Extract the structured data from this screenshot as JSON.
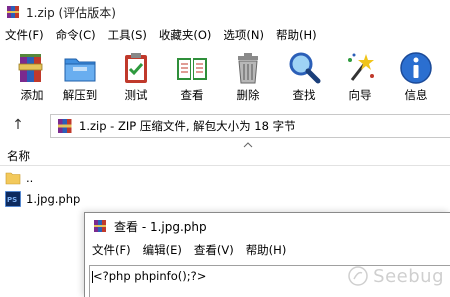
{
  "window": {
    "title": "1.zip (评估版本)"
  },
  "menu": [
    "文件(F)",
    "命令(C)",
    "工具(S)",
    "收藏夹(O)",
    "选项(N)",
    "帮助(H)"
  ],
  "toolbar": [
    {
      "label": "添加",
      "icon": "add-archive-icon"
    },
    {
      "label": "解压到",
      "icon": "extract-folder-icon"
    },
    {
      "label": "测试",
      "icon": "test-clipboard-icon"
    },
    {
      "label": "查看",
      "icon": "view-book-icon"
    },
    {
      "label": "删除",
      "icon": "trash-icon"
    },
    {
      "label": "查找",
      "icon": "magnifier-icon"
    },
    {
      "label": "向导",
      "icon": "wizard-wand-icon"
    },
    {
      "label": "信息",
      "icon": "info-icon"
    }
  ],
  "address": {
    "text": "1.zip - ZIP 压缩文件, 解包大小为 18 字节"
  },
  "list": {
    "header": "名称",
    "rows": [
      {
        "name": "..",
        "icon": "folder-icon"
      },
      {
        "name": "1.jpg.php",
        "icon": "php-file-icon"
      }
    ]
  },
  "viewer": {
    "title": "查看 - 1.jpg.php",
    "menu": [
      "文件(F)",
      "编辑(E)",
      "查看(V)",
      "帮助(H)"
    ],
    "content": "<?php phpinfo();?>"
  },
  "watermark": {
    "text": "Seebug"
  },
  "colors": {
    "winrar_red": "#c0392b",
    "winrar_blue": "#2b5fb8",
    "folder_yellow": "#f3c95b",
    "php_bg": "#0d2a5e"
  }
}
